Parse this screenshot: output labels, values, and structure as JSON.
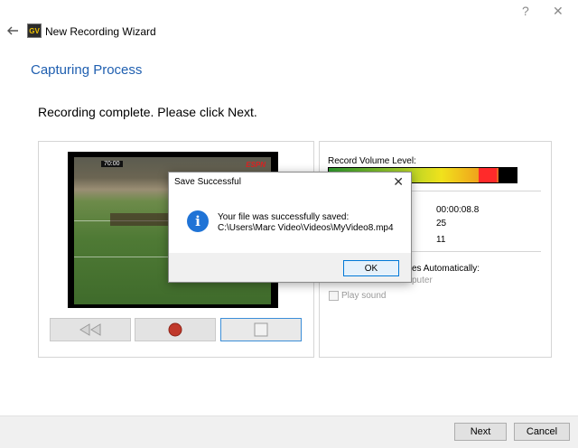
{
  "window": {
    "help_glyph": "?",
    "close_glyph": "✕",
    "title": "New Recording Wizard",
    "logo_text": "GV"
  },
  "page": {
    "section_title": "Capturing Process",
    "instruction": "Recording complete. Please click Next."
  },
  "video": {
    "scoreboard": "70:00",
    "overlay_logo": "ESPN"
  },
  "recorder": {
    "volume_label": "Record Volume Level:",
    "stats": {
      "duration": "00:00:08.8",
      "value2": "25",
      "value3": "11"
    },
    "auto_label_partial": "es Automatically:",
    "auto_option_partial": "puter",
    "play_sound_label": "Play sound",
    "play_sound_checked": false
  },
  "footer": {
    "next_label": "Next",
    "cancel_label": "Cancel"
  },
  "dialog": {
    "title": "Save Successful",
    "close_glyph": "✕",
    "icon_glyph": "i",
    "message_line1": "Your file was successfully saved:",
    "message_line2": "C:\\Users\\Marc Video\\Videos\\MyVideo8.mp4",
    "ok_label": "OK"
  },
  "colors": {
    "accent": "#1f5fb0",
    "info_icon": "#1f73d6",
    "record_button": "#c0392b"
  }
}
